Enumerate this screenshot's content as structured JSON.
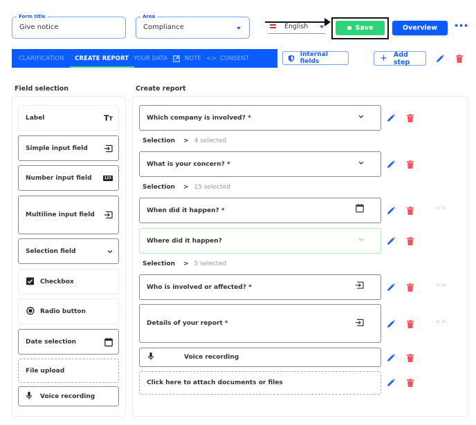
{
  "header": {
    "form_title": {
      "label": "Form title",
      "value": "Give notice"
    },
    "area": {
      "label": "Area",
      "value": "Compliance"
    },
    "language": {
      "value": "English",
      "flag_icon": "uk-flag-icon"
    },
    "save_label": "Save",
    "overview_label": "Overview",
    "more_label": "•••"
  },
  "tabs": [
    {
      "label": "CLARIFICATION",
      "active": false
    },
    {
      "label": "CREATE REPORT",
      "active": true
    },
    {
      "label": "YOUR DATA",
      "active": false
    },
    {
      "label": "NOTE",
      "active": false
    },
    {
      "label": "CONSENT",
      "active": false
    }
  ],
  "toolbar": {
    "internal_fields_label": "Internal fields",
    "add_step_label": "Add step"
  },
  "field_selection": {
    "title": "Field selection",
    "items": [
      {
        "label": "Label",
        "icon": "text-format-icon"
      },
      {
        "label": "Simple input field",
        "icon": "input-icon"
      },
      {
        "label": "Number input field",
        "icon": "number-123-icon"
      },
      {
        "label": "Multiline input field",
        "icon": "input-icon"
      },
      {
        "label": "Selection field",
        "icon": "chevron-down-icon"
      },
      {
        "label": "Checkbox",
        "icon": "checkbox-icon"
      },
      {
        "label": "Radio button",
        "icon": "radio-icon"
      },
      {
        "label": "Date selection",
        "icon": "calendar-icon"
      },
      {
        "label": "File upload",
        "icon": ""
      },
      {
        "label": "Voice recording",
        "icon": "microphone-icon"
      }
    ]
  },
  "create_report": {
    "title": "Create report",
    "items": [
      {
        "label": "Which company is involved? *",
        "icon": "chevron-down-icon",
        "selection": {
          "label": "Selection",
          "count": "4 selected"
        }
      },
      {
        "label": "What is your concern? *",
        "icon": "chevron-down-icon",
        "selection": {
          "label": "Selection",
          "count": "15 selected"
        }
      },
      {
        "label": "When did it happen? *",
        "icon": "calendar-icon"
      },
      {
        "label": "Where did it happen?",
        "icon": "chevron-down-icon",
        "selection": {
          "label": "Selection",
          "count": "5 selected"
        }
      },
      {
        "label": "Who is involved or affected? *",
        "icon": "input-icon"
      },
      {
        "label": "Details of your report *",
        "icon": "input-icon"
      },
      {
        "label": "Voice recording",
        "icon": "microphone-icon"
      },
      {
        "label": "Click here to attach documents or files",
        "icon": ""
      }
    ]
  },
  "colors": {
    "primary": "#0b5cff",
    "save_green": "#2ed47a",
    "delete_red": "#f2545b",
    "active_tab_underline": "#3ddc84"
  }
}
